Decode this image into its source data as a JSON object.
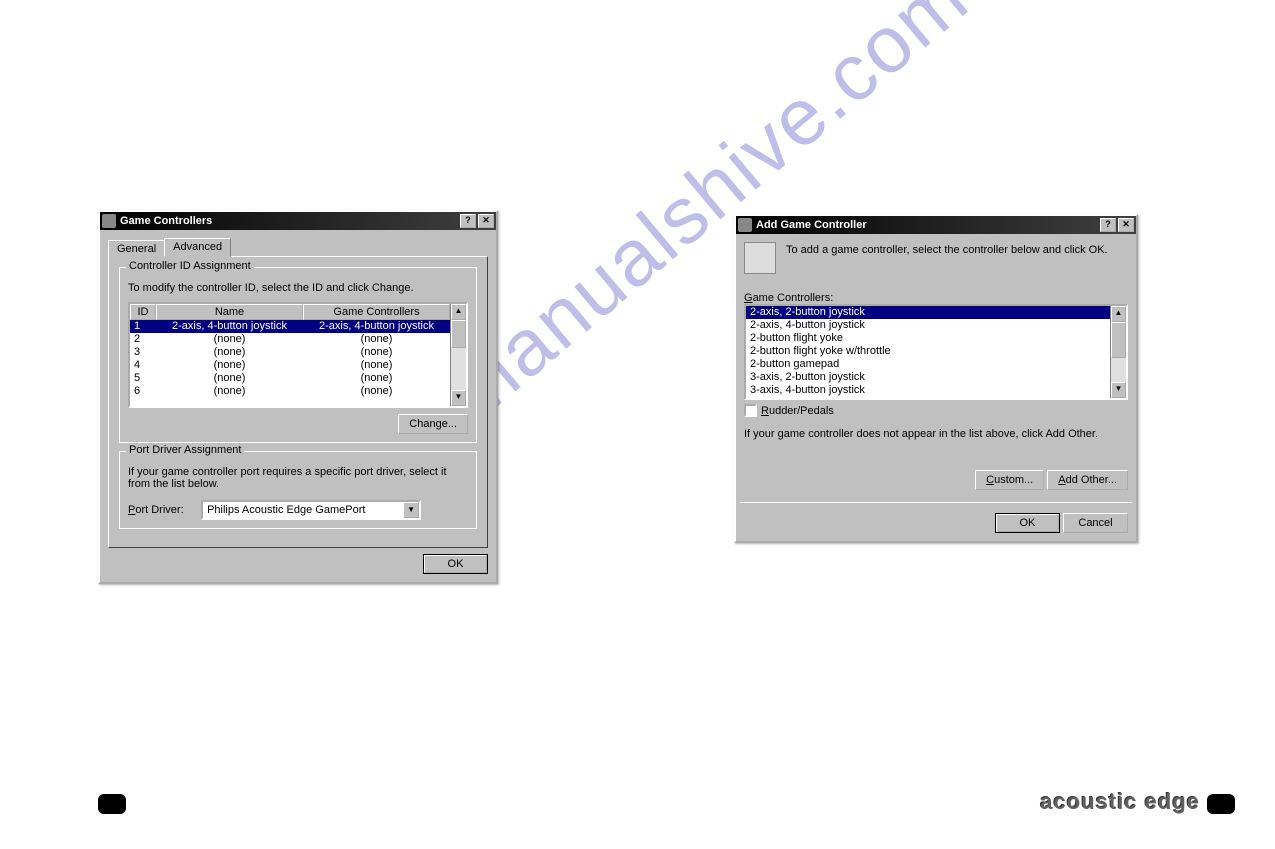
{
  "dialog1": {
    "title": "Game Controllers",
    "tabs": {
      "general": "General",
      "advanced": "Advanced"
    },
    "group1": {
      "legend": "Controller ID Assignment",
      "hint": "To modify the controller ID, select the ID and click Change.",
      "cols": {
        "id": "ID",
        "name": "Name",
        "gc": "Game Controllers"
      },
      "rows": [
        {
          "id": "1",
          "name": "2-axis, 4-button joystick",
          "gc": "2-axis, 4-button joystick",
          "selected": true
        },
        {
          "id": "2",
          "name": "(none)",
          "gc": "(none)"
        },
        {
          "id": "3",
          "name": "(none)",
          "gc": "(none)"
        },
        {
          "id": "4",
          "name": "(none)",
          "gc": "(none)"
        },
        {
          "id": "5",
          "name": "(none)",
          "gc": "(none)"
        },
        {
          "id": "6",
          "name": "(none)",
          "gc": "(none)"
        }
      ],
      "change": "Change..."
    },
    "group2": {
      "legend": "Port Driver Assignment",
      "hint": "If your game controller port requires a specific port driver, select it from the list below.",
      "portdriver_label_pre": "P",
      "portdriver_label_rest": "ort Driver:",
      "portdriver_value": "Philips Acoustic Edge GamePort"
    },
    "ok": "OK"
  },
  "dialog2": {
    "title": "Add Game Controller",
    "hint": "To add a game controller, select the controller below and click OK.",
    "listlabel_pre": "G",
    "listlabel_rest": "ame Controllers:",
    "items": [
      {
        "label": "2-axis, 2-button joystick",
        "selected": true
      },
      {
        "label": "2-axis, 4-button joystick"
      },
      {
        "label": "2-button flight yoke"
      },
      {
        "label": "2-button flight yoke w/throttle"
      },
      {
        "label": "2-button gamepad"
      },
      {
        "label": "3-axis, 2-button joystick"
      },
      {
        "label": "3-axis, 4-button joystick"
      }
    ],
    "rudder_pre": "R",
    "rudder_rest": "udder/Pedals",
    "note": "If your game controller does not appear in the list above, click Add Other.",
    "custom_pre": "C",
    "custom_rest": "ustom...",
    "addother_pre": "A",
    "addother_rest": "dd Other...",
    "ok": "OK",
    "cancel": "Cancel"
  },
  "watermark": "manualshive.com",
  "footer_logo": "acoustic edge"
}
